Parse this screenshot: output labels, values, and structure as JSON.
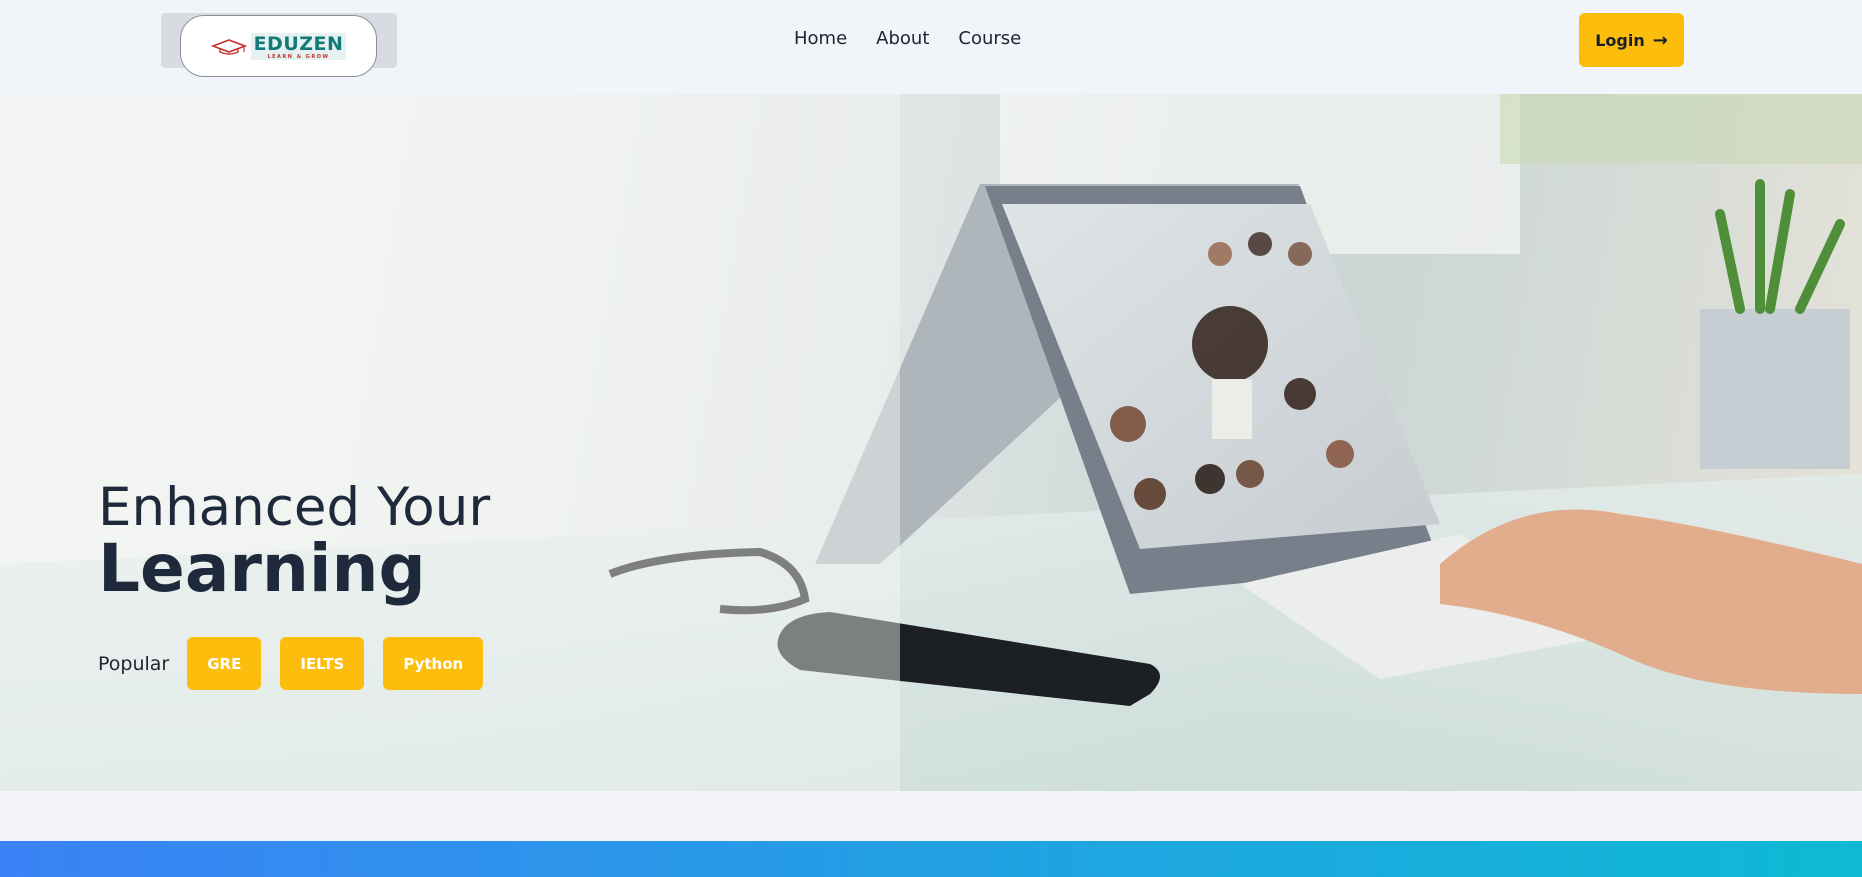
{
  "navbar": {
    "logo": {
      "word": "EDUZEN",
      "tagline": "LEARN & GROW"
    },
    "links": [
      "Home",
      "About",
      "Course"
    ],
    "login_label": "Login",
    "login_icon": "arrow-right-icon"
  },
  "hero": {
    "line1": "Enhanced Your",
    "line2": "Learning",
    "popular_label": "Popular",
    "tags": [
      "GRE",
      "IELTS",
      "Python"
    ]
  },
  "colors": {
    "accent": "#fcbd0c",
    "text_dark": "#1e2a3b",
    "logo_teal": "#127a78",
    "bar_start": "#3b82f6",
    "bar_end": "#0fb9d4"
  }
}
